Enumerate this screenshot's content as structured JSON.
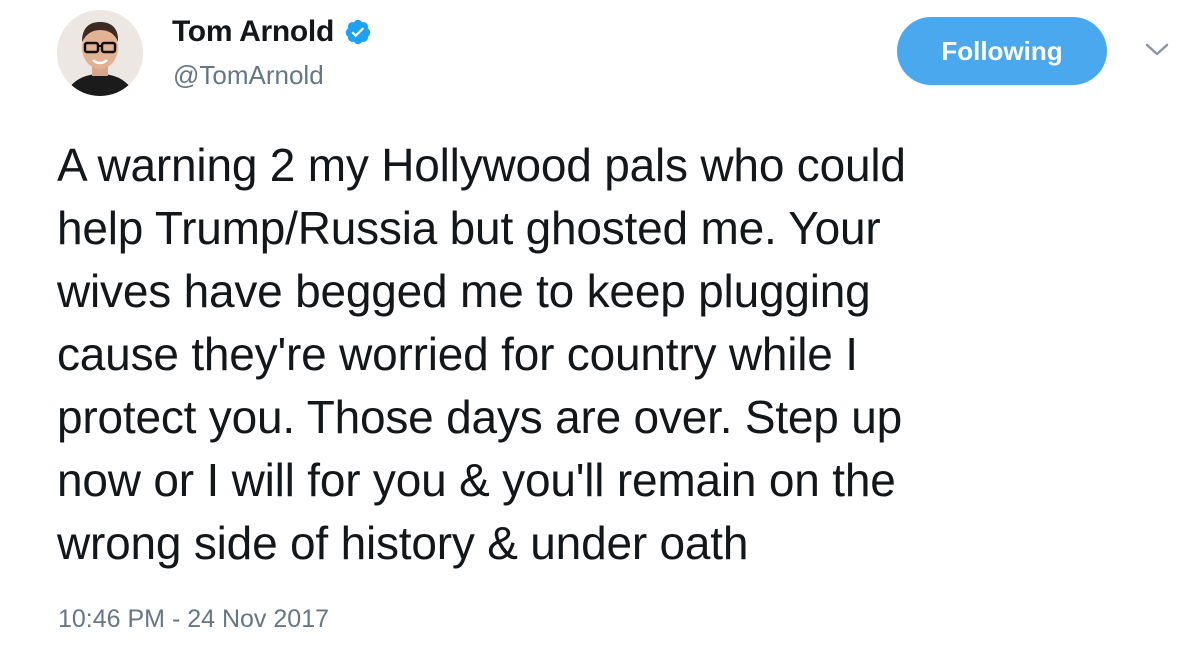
{
  "author": {
    "display_name": "Tom Arnold",
    "handle": "@TomArnold",
    "verified": true,
    "avatar_icon": "profile-photo"
  },
  "follow_button": {
    "label": "Following",
    "color": "#4aa9ee"
  },
  "menu": {
    "icon": "chevron-down-icon"
  },
  "tweet": {
    "text": "A warning 2 my Hollywood pals who could\nhelp Trump/Russia but ghosted me. Your\nwives have begged me to keep plugging\ncause they're worried for country while I\nprotect you. Those days are over. Step up\nnow or I will for you & you'll remain on the\nwrong side of history & under oath",
    "timestamp": "10:46 PM - 24 Nov 2017"
  },
  "colors": {
    "text": "#14171a",
    "secondary": "#657786",
    "verified_badge": "#1da1f2"
  }
}
